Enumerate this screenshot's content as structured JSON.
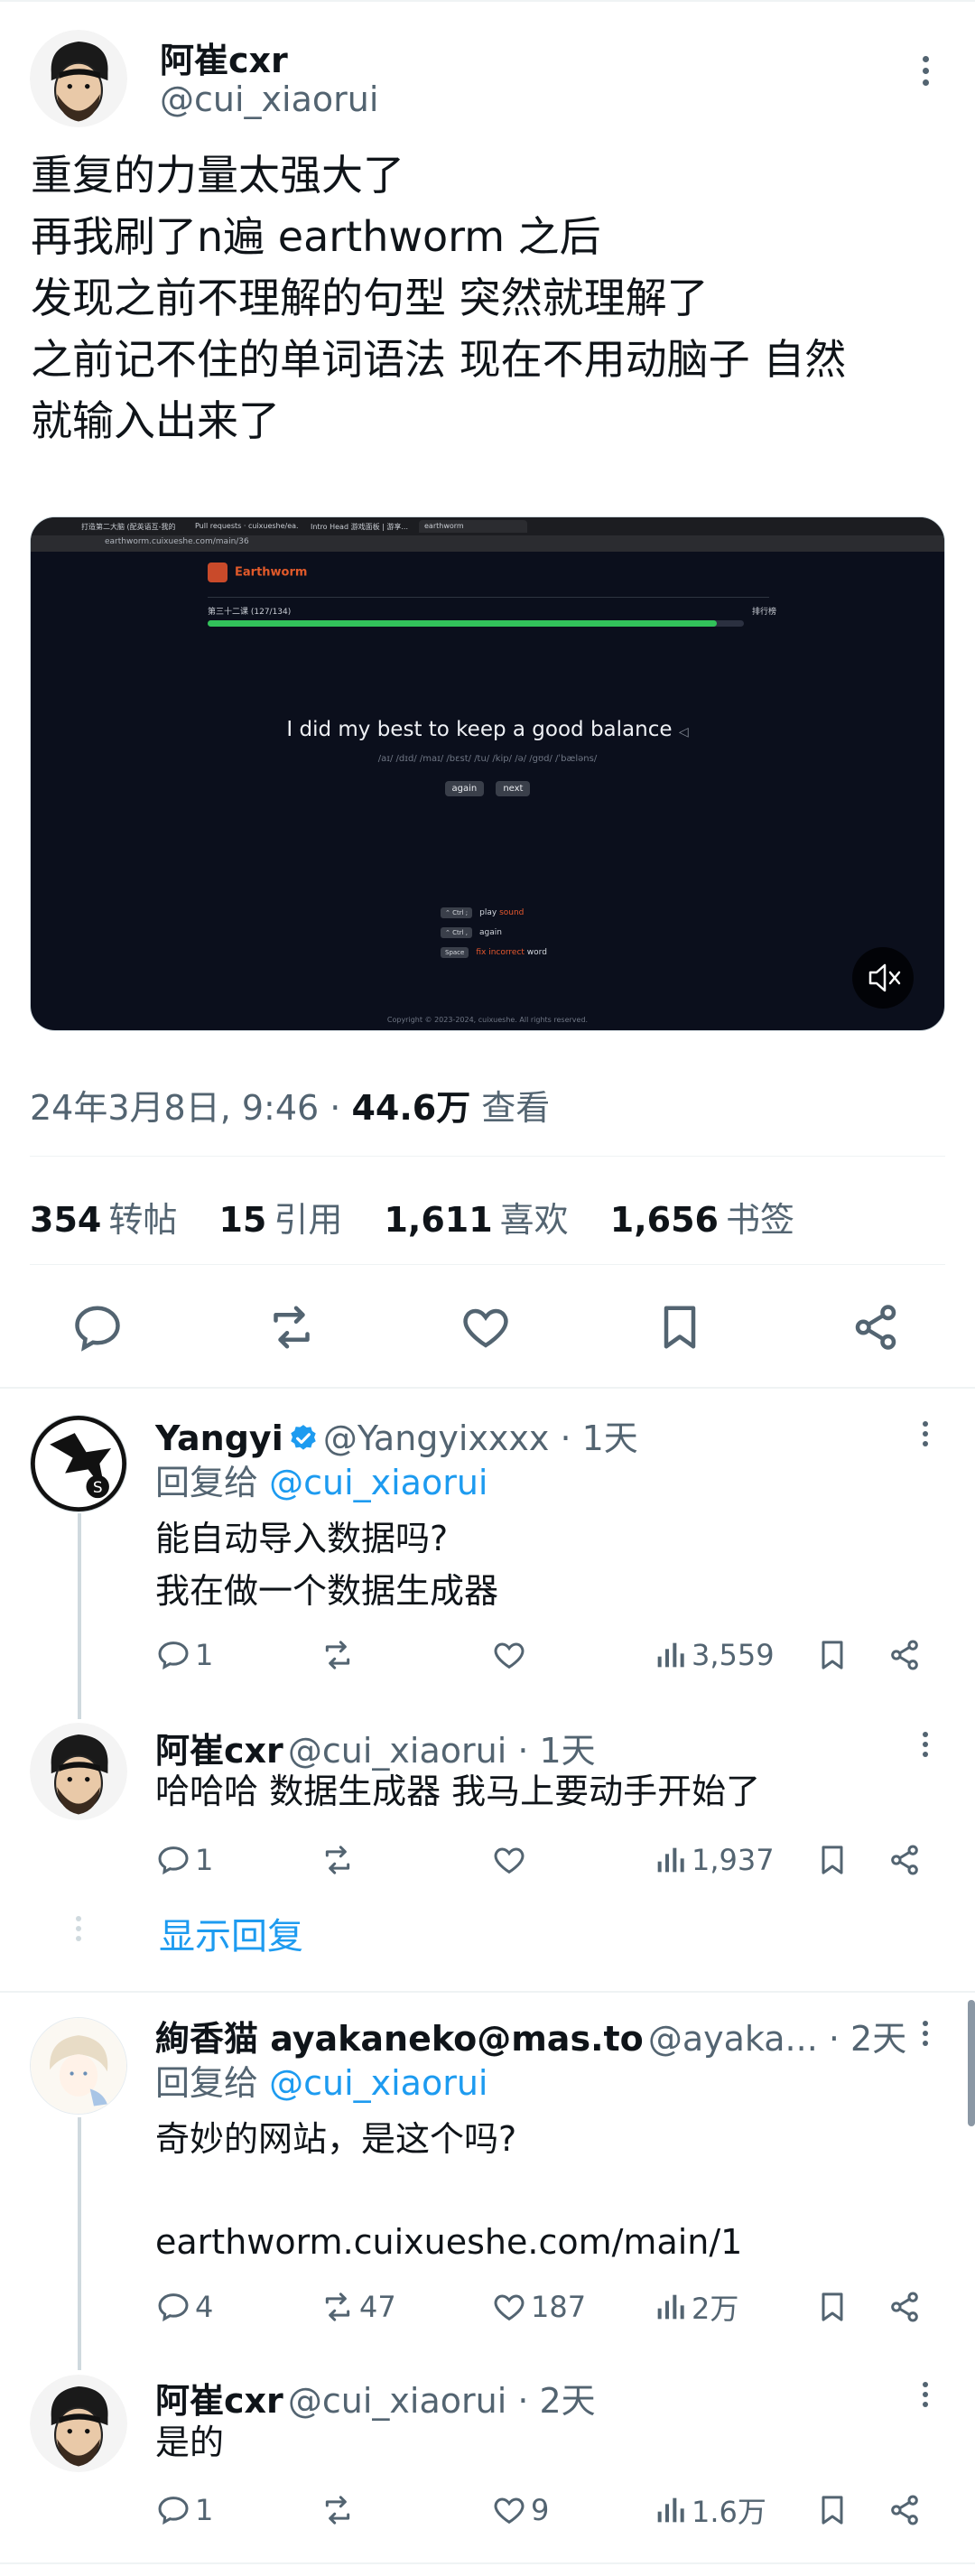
{
  "main_tweet": {
    "author_name": "阿崔cxr",
    "author_handle": "@cui_xiaorui",
    "text_lines": [
      "重复的力量太强大了",
      "再我刷了n遍 earthworm 之后",
      "发现之前不理解的句型 突然就理解了",
      "之前记不住的单词语法 现在不用动脑子 自然",
      "就输入出来了"
    ],
    "timestamp": "24年3月8日, 9:46 · ",
    "views_count": "44.6万",
    "views_label": "查看",
    "stats": [
      {
        "count": "354",
        "label": "转帖"
      },
      {
        "count": "15",
        "label": "引用"
      },
      {
        "count": "1,611",
        "label": "喜欢"
      },
      {
        "count": "1,656",
        "label": "书签"
      }
    ]
  },
  "media": {
    "url": "earthworm.cuixueshe.com/main/36",
    "tabs": [
      "打造第二大脑 (配英语互-我的",
      "Pull requests · cuixueshe/ea...",
      "Intro Head 游戏面板 | 游享...",
      "earthworm"
    ],
    "app_name": "Earthworm",
    "lesson": "第三十二课 (127/134)",
    "rank_label": "排行榜",
    "progress": 0.95,
    "sentence": "I did my best to keep a good balance",
    "phonetic": "/aɪ/ /dɪd/ /maɪ/ /bɛst/ /tu/ /kip/ /ə/ /gʊd/ /ˈbæləns/",
    "btn_again": "again",
    "btn_next": "next",
    "shortcuts": [
      {
        "key": "⌃ Ctrl ;",
        "pre": "play ",
        "highlight": "sound",
        "post": ""
      },
      {
        "key": "⌃ Ctrl ,",
        "pre": "again",
        "highlight": "",
        "post": ""
      },
      {
        "key": "Space",
        "pre": "",
        "highlight": "fix incorrect",
        "post": " word"
      }
    ],
    "copyright": "Copyright © 2023-2024, cuixueshe. All rights reserved."
  },
  "replies": [
    {
      "name": "Yangyi",
      "verified": true,
      "handle": "@Yangyixxxx · 1天",
      "reply_to_prefix": "回复给 ",
      "reply_to": "@cui_xiaorui",
      "lines": [
        "能自动导入数据吗?",
        "我在做一个数据生成器"
      ],
      "replies": "1",
      "retweets": "",
      "likes": "",
      "views": "3,559"
    },
    {
      "name": "阿崔cxr",
      "handle": "@cui_xiaorui · 1天",
      "lines": [
        "哈哈哈 数据生成器 我马上要动手开始了"
      ],
      "replies": "1",
      "retweets": "",
      "likes": "",
      "views": "1,937"
    },
    {
      "name": "絢香猫 ayakaneko@mas.to",
      "handle": "@ayaka... · 2天",
      "reply_to_prefix": "回复给 ",
      "reply_to": "@cui_xiaorui",
      "lines": [
        "奇妙的网站，是这个吗?"
      ],
      "link": "earthworm.cuixueshe.com/main/1",
      "replies": "4",
      "retweets": "47",
      "likes": "187",
      "views": "2万"
    },
    {
      "name": "阿崔cxr",
      "handle": "@cui_xiaorui · 2天",
      "lines": [
        "是的"
      ],
      "replies": "1",
      "retweets": "",
      "likes": "9",
      "views": "1.6万"
    }
  ],
  "show_replies_label": "显示回复",
  "colors": {
    "accent": "#1d9bf0",
    "text": "#0f1419",
    "secondary": "#536471"
  }
}
